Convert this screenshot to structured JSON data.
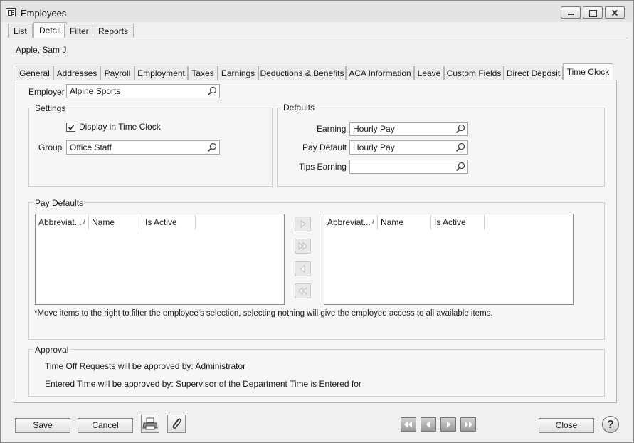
{
  "window": {
    "title": "Employees"
  },
  "top_tabs": [
    "List",
    "Detail",
    "Filter",
    "Reports"
  ],
  "employee_name": "Apple, Sam J",
  "sub_tabs": [
    "General",
    "Addresses",
    "Payroll",
    "Employment",
    "Taxes",
    "Earnings",
    "Deductions & Benefits",
    "ACA Information",
    "Leave",
    "Custom Fields",
    "Direct Deposit",
    "Time Clock"
  ],
  "employer": {
    "label": "Employer",
    "value": "Alpine Sports"
  },
  "settings": {
    "title": "Settings",
    "checkbox_label": "Display in Time Clock",
    "checked": true,
    "group_label": "Group",
    "group_value": "Office Staff"
  },
  "defaults": {
    "title": "Defaults",
    "earning_label": "Earning",
    "earning_value": "Hourly Pay",
    "pay_default_label": "Pay Default",
    "pay_default_value": "Hourly Pay",
    "tips_label": "Tips Earning",
    "tips_value": ""
  },
  "pay_defaults": {
    "title": "Pay Defaults",
    "left_columns": [
      "Abbreviat...",
      "Name",
      "Is Active"
    ],
    "right_columns": [
      "Abbreviat...",
      "Name",
      "Is Active"
    ],
    "note": "*Move items to the right to filter the employee's selection, selecting nothing will give the employee access to all available items."
  },
  "approval": {
    "title": "Approval",
    "time_off": "Time Off Requests will be approved by: Administrator",
    "entered_time": "Entered Time will be approved by: Supervisor of the Department Time is Entered for"
  },
  "footer": {
    "save": "Save",
    "cancel": "Cancel",
    "close": "Close",
    "help": "?"
  },
  "icons": [
    "magnifier-icon",
    "printer-icon",
    "paperclip-icon",
    "first-record-icon",
    "previous-record-icon",
    "next-record-icon",
    "last-record-icon",
    "help-icon",
    "sort-icon"
  ]
}
